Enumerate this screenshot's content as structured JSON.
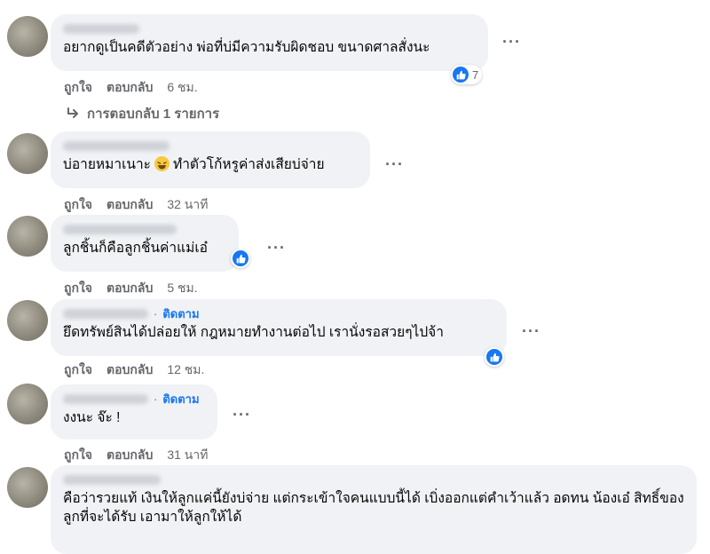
{
  "comments": [
    {
      "text": "อยากดูเป็นคดีตัวอย่าง พ่อที่บ่มีความรับผิดชอบ ขนาดศาลสั่งนะ",
      "like_label": "ถูกใจ",
      "reply_label": "ตอบกลับ",
      "time": "6 ชม.",
      "reaction_count": "7",
      "replies_label": "การตอบกลับ 1 รายการ"
    },
    {
      "text_before": "บ่อายหมาเนาะ",
      "text_after": "ทำตัวโก้หรูค่าส่งเสียบ่จ่าย",
      "emoji": "laughing-emoji",
      "like_label": "ถูกใจ",
      "reply_label": "ตอบกลับ",
      "time": "32 นาที"
    },
    {
      "text": "ลูกชิ้นก็คือลูกชิ้นค่าแม่เอ๋",
      "like_label": "ถูกใจ",
      "reply_label": "ตอบกลับ",
      "time": "5 ชม."
    },
    {
      "follow": "ติดตาม",
      "text": "ยึดทรัพย์สินได้ปล่อยให้ กฎหมายทำงานต่อไป เรานั่งรอสวยๆไปจ้า",
      "like_label": "ถูกใจ",
      "reply_label": "ตอบกลับ",
      "time": "12 ชม."
    },
    {
      "follow": "ติดตาม",
      "text": "งงนะ จ๊ะ !",
      "like_label": "ถูกใจ",
      "reply_label": "ตอบกลับ",
      "time": "31 นาที"
    },
    {
      "text": "คือว่ารวยแท้ เงินให้ลูกแค่นี้ยังบ่จ่าย แต่กระเข้าใจคนแบบนี้ได้ เบิ่งออกแต่คำเว้าแล้ว อดทน น้องเอ๋ สิทธิ์ของลูกที่จะได้รับ เอามาให้ลูกให้ได้"
    }
  ],
  "colors": {
    "bubble": "#f0f2f5",
    "accent": "#1877f2",
    "secondary_text": "#65676b"
  }
}
